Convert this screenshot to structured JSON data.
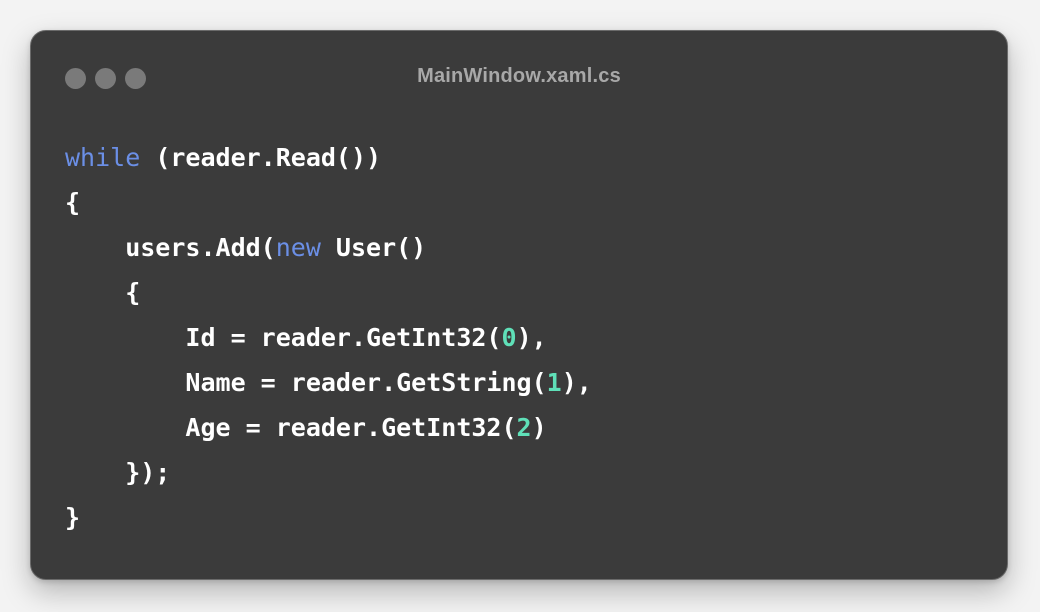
{
  "window": {
    "title": "MainWindow.xaml.cs",
    "dots": [
      "window-dot-1",
      "window-dot-2",
      "window-dot-3"
    ]
  },
  "code": {
    "language": "C#",
    "lines": [
      [
        {
          "t": "while",
          "c": "kw"
        },
        {
          "t": " (reader.Read())",
          "c": "plain"
        }
      ],
      [
        {
          "t": "{",
          "c": "plain"
        }
      ],
      [
        {
          "t": "    users.Add(",
          "c": "plain"
        },
        {
          "t": "new",
          "c": "kw"
        },
        {
          "t": " User()",
          "c": "plain"
        }
      ],
      [
        {
          "t": "    {",
          "c": "plain"
        }
      ],
      [
        {
          "t": "        Id = reader.GetInt32(",
          "c": "plain"
        },
        {
          "t": "0",
          "c": "num"
        },
        {
          "t": "),",
          "c": "plain"
        }
      ],
      [
        {
          "t": "        Name = reader.GetString(",
          "c": "plain"
        },
        {
          "t": "1",
          "c": "num"
        },
        {
          "t": "),",
          "c": "plain"
        }
      ],
      [
        {
          "t": "        Age = reader.GetInt32(",
          "c": "plain"
        },
        {
          "t": "2",
          "c": "num"
        },
        {
          "t": ")",
          "c": "plain"
        }
      ],
      [
        {
          "t": "    });",
          "c": "plain"
        }
      ],
      [
        {
          "t": "}",
          "c": "plain"
        }
      ]
    ]
  },
  "colors": {
    "background": "#3b3b3b",
    "keyword": "#6b8fe6",
    "number": "#5fe0b8",
    "text": "#ffffff",
    "title": "#a8a8a8",
    "dot": "#7a7a7a"
  }
}
